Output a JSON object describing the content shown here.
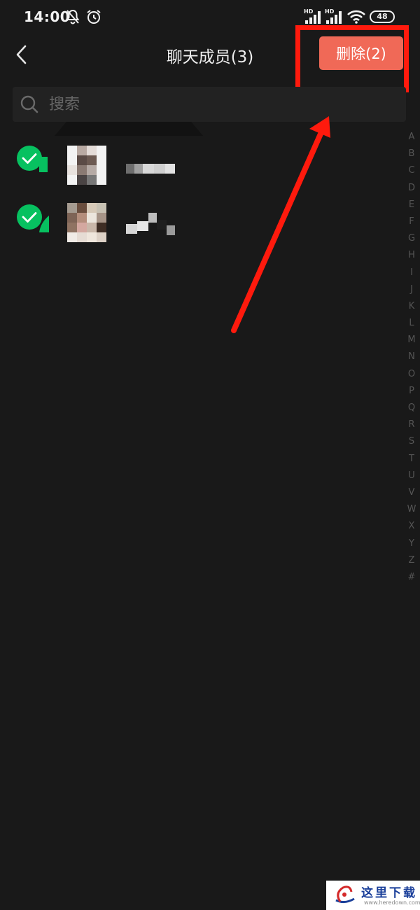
{
  "status_bar": {
    "time": "14:00",
    "battery": "48",
    "signal_badges": [
      "HD",
      "HD"
    ],
    "icons": [
      "mute-notification-icon",
      "alarm-icon",
      "signal-icon",
      "wifi-icon",
      "battery-icon"
    ]
  },
  "nav": {
    "title": "聊天成员(3)",
    "delete_label": "删除(2)",
    "back_icon": "chevron-left-icon"
  },
  "search": {
    "placeholder": "搜索"
  },
  "members": [
    {
      "selected": true
    },
    {
      "selected": true
    }
  ],
  "index_letters": [
    "A",
    "B",
    "C",
    "D",
    "E",
    "F",
    "G",
    "H",
    "I",
    "J",
    "K",
    "L",
    "M",
    "N",
    "O",
    "P",
    "Q",
    "R",
    "S",
    "T",
    "U",
    "V",
    "W",
    "X",
    "Y",
    "Z",
    "#"
  ],
  "colors": {
    "background": "#191919",
    "accent_green": "#07c160",
    "delete_button": "#f06957",
    "annotation_red": "#ff1a0d"
  },
  "watermark": {
    "text": "这里下载",
    "url": "www.heredown.com"
  }
}
